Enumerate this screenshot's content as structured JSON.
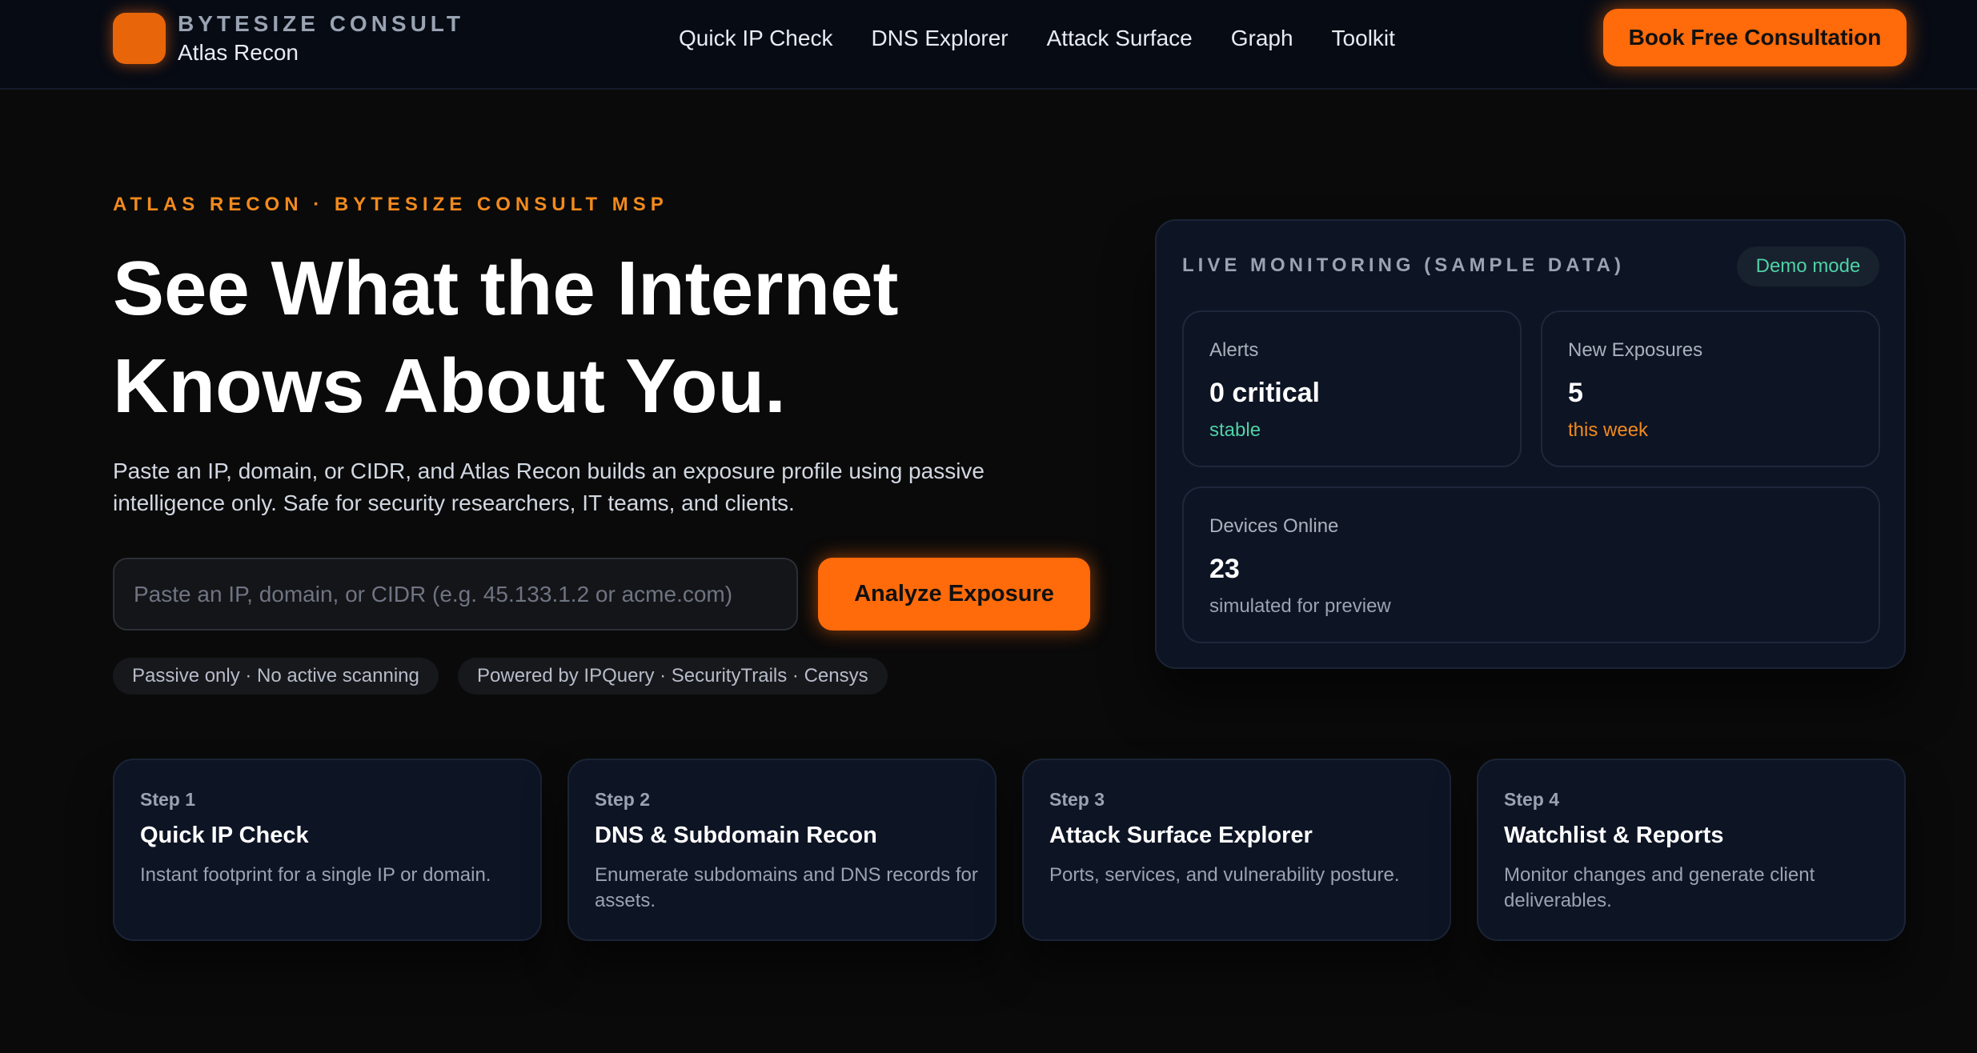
{
  "nav": {
    "brand_name": "BYTESIZE CONSULT",
    "brand_product": "Atlas Recon",
    "links": [
      "Quick IP Check",
      "DNS Explorer",
      "Attack Surface",
      "Graph",
      "Toolkit"
    ],
    "cta_label": "Book Free Consultation"
  },
  "hero": {
    "eyebrow": "ATLAS RECON · BYTESIZE CONSULT MSP",
    "headline_line1": "See What the Internet",
    "headline_line2": "Knows About You.",
    "intro": "Paste an IP, domain, or CIDR, and Atlas Recon builds an exposure profile using passive intelligence only. Safe for security researchers, IT teams, and clients.",
    "search_placeholder": "Paste an IP, domain, or CIDR (e.g. 45.133.1.2 or acme.com)",
    "search_value": "",
    "analyze_label": "Analyze Exposure",
    "pills": [
      "Passive only · No active scanning",
      "Powered by IPQuery · SecurityTrails · Censys"
    ]
  },
  "monitor": {
    "title": "LIVE MONITORING (SAMPLE DATA)",
    "badge": "Demo mode",
    "metrics": [
      {
        "label": "Alerts",
        "value": "0 critical",
        "note": "stable"
      },
      {
        "label": "New Exposures",
        "value": "5",
        "note": "this week"
      },
      {
        "label": "Devices Online",
        "value": "23",
        "note": "simulated for preview"
      }
    ]
  },
  "steps": [
    {
      "num": "Step 1",
      "title": "Quick IP Check",
      "desc": "Instant footprint for a single IP or domain."
    },
    {
      "num": "Step 2",
      "title": "DNS & Subdomain Recon",
      "desc": "Enumerate subdomains and DNS records for assets."
    },
    {
      "num": "Step 3",
      "title": "Attack Surface Explorer",
      "desc": "Ports, services, and vulnerability posture."
    },
    {
      "num": "Step 4",
      "title": "Watchlist & Reports",
      "desc": "Monitor changes and generate client deliverables."
    }
  ],
  "colors": {
    "accent": "#ff6a0a",
    "eyebrow": "#f28a1d",
    "stable": "#4fd1a5",
    "warning": "#f28a1d",
    "muted": "#9aa3b2",
    "card_bg": "#0d1424"
  }
}
